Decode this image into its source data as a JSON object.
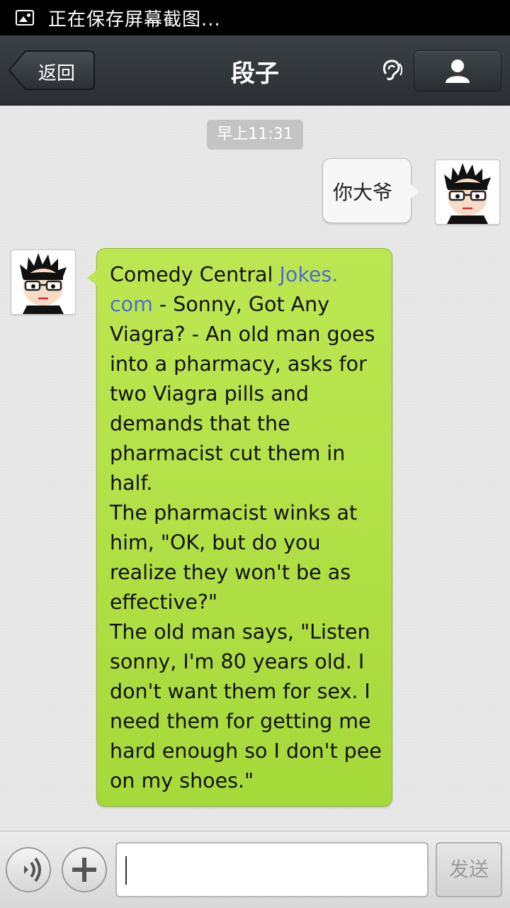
{
  "status_bar": {
    "text": "正在保存屏幕截图..."
  },
  "header": {
    "back_label": "返回",
    "title": "段子"
  },
  "chat": {
    "timestamp": "早上11:31",
    "outgoing_message": "你大爷",
    "incoming_message": {
      "prefix": "Comedy Central ",
      "link": "Jokes.\ncom",
      "body": " - Sonny, Got Any\nViagra? - An old man goes\ninto a pharmacy, asks for\ntwo Viagra pills and\ndemands that the\npharmacist cut them in\nhalf.\nThe pharmacist winks at\nhim, \"OK, but do you\nrealize they won't be as\neffective?\"\nThe old man says, \"Listen\nsonny, I'm 80 years old. I\ndon't want them for sex. I\nneed them for getting me\nhard enough so I don't pee\non my shoes.\""
    }
  },
  "input_bar": {
    "input_value": "",
    "send_label": "发送"
  },
  "colors": {
    "incoming_bubble": "#a6d93a",
    "link": "#4f6bd1",
    "title_bar": "#2f3438"
  },
  "icons": [
    "image-icon",
    "ear-icon",
    "profile-icon",
    "voice-icon",
    "plus-icon"
  ]
}
